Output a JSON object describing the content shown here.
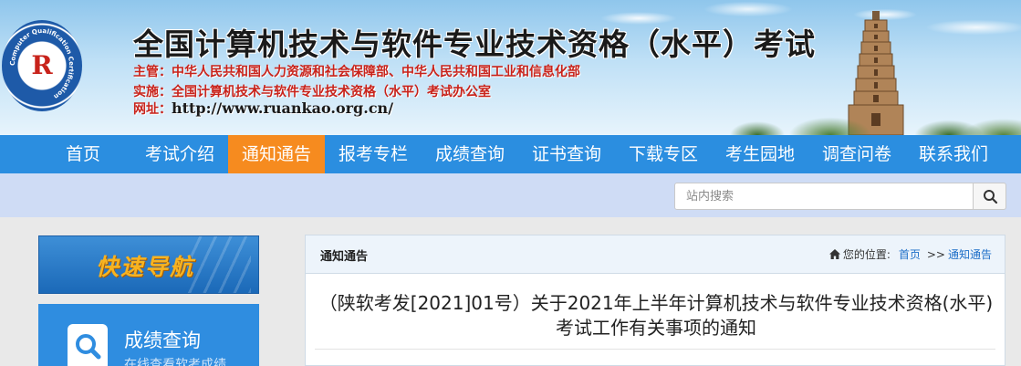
{
  "header": {
    "logo_text": "R",
    "logo_ring_text": "Computer Qualification Certification",
    "title": "全国计算机技术与软件专业技术资格（水平）考试",
    "sponsor_label": "主管：",
    "sponsor_value": "中华人民共和国人力资源和社会保障部、中华人民共和国工业和信息化部",
    "organizer_label": "实施：",
    "organizer_value": "全国计算机技术与软件专业技术资格（水平）考试办公室",
    "website_label": "网址：",
    "website_value": "http://www.ruankao.org.cn/"
  },
  "nav": {
    "items": [
      {
        "label": "首页"
      },
      {
        "label": "考试介绍"
      },
      {
        "label": "通知通告",
        "active": true
      },
      {
        "label": "报考专栏"
      },
      {
        "label": "成绩查询"
      },
      {
        "label": "证书查询"
      },
      {
        "label": "下载专区"
      },
      {
        "label": "考生园地"
      },
      {
        "label": "调查问卷"
      },
      {
        "label": "联系我们"
      }
    ]
  },
  "search": {
    "placeholder": "站内搜索",
    "icon": "search-icon"
  },
  "sidebar": {
    "quick_nav_label": "快速导航",
    "score_card": {
      "title": "成绩查询",
      "subtitle": "在线查看软考成绩",
      "icon": "magnifier-document-icon"
    }
  },
  "content": {
    "section_title": "通知通告",
    "breadcrumb": {
      "home_icon": "home-icon",
      "prefix": "您的位置:",
      "home": "首页",
      "separator": ">>",
      "current": "通知通告"
    },
    "article_title": "（陕软考发[2021]01号）关于2021年上半年计算机技术与软件专业技术资格(水平)考试工作有关事项的通知"
  },
  "colors": {
    "nav_bg": "#2b8ee0",
    "nav_active": "#f68b1f",
    "search_band": "#cfdcf5",
    "quick_nav_text": "#f7b321",
    "link": "#1e6fc8"
  }
}
